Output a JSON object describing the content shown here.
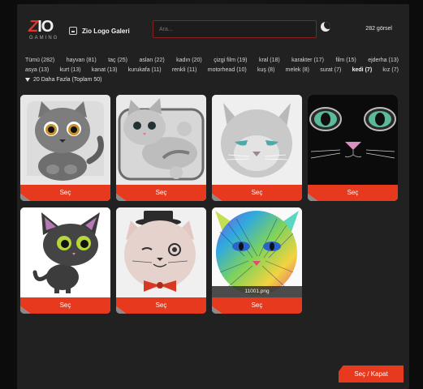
{
  "brand": {
    "logo_text": "ZIO",
    "logo_sub": "GAMING"
  },
  "header": {
    "title": "Zio Logo Galeri",
    "search_placeholder": "Ara...",
    "image_count": "282 görsel"
  },
  "tags": {
    "row1": [
      {
        "label": "Tümü",
        "count": "(282)"
      },
      {
        "label": "hayvan",
        "count": "(81)"
      },
      {
        "label": "taç",
        "count": "(25)"
      },
      {
        "label": "aslan",
        "count": "(22)"
      },
      {
        "label": "kadın",
        "count": "(20)"
      },
      {
        "label": "çizgi film",
        "count": "(19)"
      },
      {
        "label": "kral",
        "count": "(18)"
      },
      {
        "label": "karakter",
        "count": "(17)"
      },
      {
        "label": "film",
        "count": "(15)"
      },
      {
        "label": "ejderha",
        "count": "(13)"
      }
    ],
    "row2": [
      {
        "label": "asya",
        "count": "(13)"
      },
      {
        "label": "kurt",
        "count": "(13)"
      },
      {
        "label": "kanat",
        "count": "(13)"
      },
      {
        "label": "kurukafa",
        "count": "(11)"
      },
      {
        "label": "renkli",
        "count": "(11)"
      },
      {
        "label": "motorhead",
        "count": "(10)"
      },
      {
        "label": "kuş",
        "count": "(8)"
      },
      {
        "label": "melek",
        "count": "(8)"
      },
      {
        "label": "surat",
        "count": "(7)"
      },
      {
        "label": "kedi",
        "count": "(7)"
      },
      {
        "label": "kız",
        "count": "(7)"
      }
    ],
    "more_label": "20 Daha Fazla (Toplam 50)"
  },
  "cards": [
    {
      "select_label": "Seç",
      "art": "cartoon-gray-kitten"
    },
    {
      "select_label": "Seç",
      "art": "cartoon-lying-kitten"
    },
    {
      "select_label": "Seç",
      "art": "realistic-white-cat"
    },
    {
      "select_label": "Seç",
      "art": "black-cat-green-eyes"
    },
    {
      "select_label": "Seç",
      "art": "cartoon-black-kitten"
    },
    {
      "select_label": "Seç",
      "art": "gentleman-cat-monocle"
    },
    {
      "select_label": "Seç",
      "art": "colorful-cat",
      "filename": "11001.png"
    }
  ],
  "footer": {
    "close_label": "Seç / Kapat"
  },
  "colors": {
    "accent": "#e6391e",
    "panel": "#212121",
    "background": "#101010"
  }
}
